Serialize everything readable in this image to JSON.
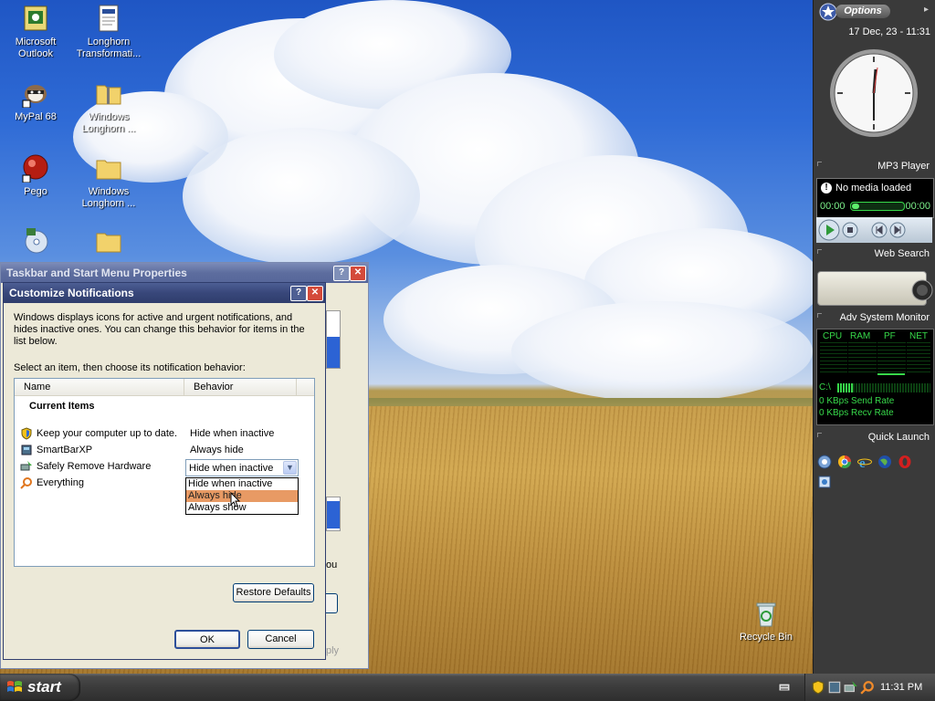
{
  "desktop": {
    "icons": [
      {
        "label": "Microsoft Outlook",
        "icon": "outlook-icon"
      },
      {
        "label": "Longhorn Transformati...",
        "icon": "document-icon"
      },
      {
        "label": "MyPal 68",
        "icon": "mypal-icon"
      },
      {
        "label": "Windows Longhorn ...",
        "icon": "zip-folder-icon"
      },
      {
        "label": "Pego",
        "icon": "pego-icon"
      },
      {
        "label": "Windows Longhorn ...",
        "icon": "folder-icon"
      },
      {
        "label": "",
        "icon": "media-icon"
      },
      {
        "label": "",
        "icon": "folder-icon"
      }
    ],
    "recycle_bin": "Recycle Bin"
  },
  "back_window": {
    "title": "Taskbar and Start Menu Properties",
    "partial_text_1": "ou",
    "partial_text_2": "ply"
  },
  "dialog": {
    "title": "Customize Notifications",
    "description": "Windows displays icons for active and urgent notifications, and hides inactive ones. You can change this behavior for items in the list below.",
    "instruction": "Select an item, then choose its notification behavior:",
    "columns": {
      "name": "Name",
      "behavior": "Behavior"
    },
    "section": "Current Items",
    "items": [
      {
        "name": "Keep your computer up to date.",
        "behavior": "Hide when inactive"
      },
      {
        "name": "SmartBarXP",
        "behavior": "Always hide"
      },
      {
        "name": "Safely Remove Hardware",
        "behavior": "Hide when inactive"
      },
      {
        "name": "Everything",
        "behavior": ""
      }
    ],
    "dropdown_options": [
      "Hide when inactive",
      "Always hide",
      "Always show"
    ],
    "dropdown_highlighted": "Always hide",
    "restore_defaults": "Restore Defaults",
    "ok": "OK",
    "cancel": "Cancel"
  },
  "sidebar": {
    "options_label": "Options",
    "datetime": "17 Dec, 23 - 11:31",
    "mp3": {
      "title": "MP3 Player",
      "status": "No media loaded",
      "time_start": "00:00",
      "time_end": "00:00"
    },
    "web_search": {
      "title": "Web Search"
    },
    "sysmon": {
      "title": "Adv System Monitor",
      "labels": [
        "CPU",
        "RAM",
        "PF",
        "NET"
      ],
      "drive": "C:\\",
      "send_rate": "0 KBps Send Rate",
      "recv_rate": "0 KBps Recv Rate"
    },
    "quick_launch": {
      "title": "Quick Launch"
    }
  },
  "taskbar": {
    "start_label": "start",
    "clock": "11:31 PM"
  },
  "colors": {
    "title_active": "#38477a",
    "dropdown_highlight": "#e89a64",
    "sidebar_bg": "#3a3a3a",
    "monitor_green": "#37d94a"
  }
}
